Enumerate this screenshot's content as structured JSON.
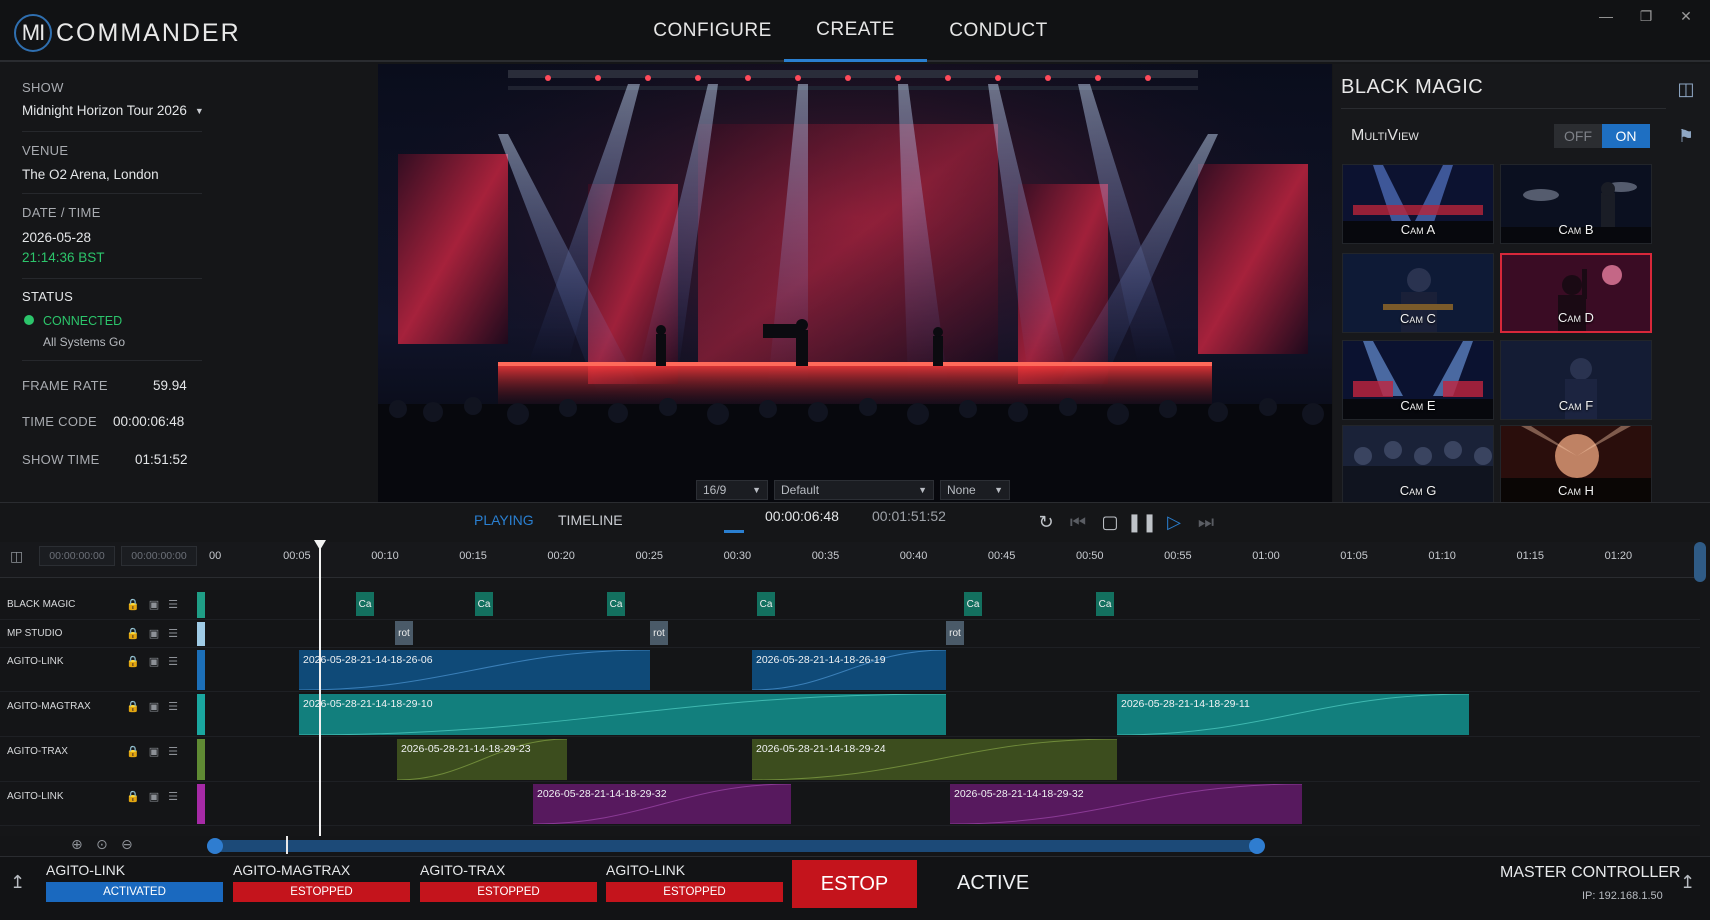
{
  "app": {
    "logo_mark": "MI",
    "logo_text": "COMMANDER",
    "nav": [
      {
        "label": "CONFIGURE"
      },
      {
        "label": "CREATE",
        "active": true
      },
      {
        "label": "CONDUCT"
      }
    ],
    "window_controls": [
      "minimize-icon",
      "restore-icon",
      "close-icon"
    ]
  },
  "show_info": {
    "show_label": "SHOW",
    "show_value": "Midnight Horizon Tour 2026",
    "venue_label": "VENUE",
    "venue_value": "The O2 Arena, London",
    "datetime_label": "DATE / TIME",
    "date_value": "2026-05-28",
    "time_value": "21:14:36 BST",
    "status_label": "STATUS",
    "status_value": "CONNECTED",
    "status_sub": "All Systems Go",
    "frame_rate_label": "FRAME RATE",
    "frame_rate_value": "59.94",
    "time_code_label": "TIME CODE",
    "time_code_value": "00:00:06:48",
    "show_time_label": "SHOW TIME",
    "show_time_value": "01:51:52",
    "status_color": "#2cc56b"
  },
  "viewer": {
    "aspect": "16/9",
    "preset": "Default",
    "overlay": "None"
  },
  "black_magic": {
    "title": "BLACK MAGIC",
    "multiview_label": "MultiView",
    "toggle_off": "OFF",
    "toggle_on": "ON",
    "toggle_state": "ON",
    "cameras": [
      {
        "label": "Cam A"
      },
      {
        "label": "Cam B"
      },
      {
        "label": "Cam C"
      },
      {
        "label": "Cam D",
        "selected": true
      },
      {
        "label": "Cam E"
      },
      {
        "label": "Cam F"
      },
      {
        "label": "Cam G"
      },
      {
        "label": "Cam H"
      }
    ]
  },
  "transport": {
    "tab_playing": "PLAYING",
    "tab_timeline": "TIMELINE",
    "current_time": "00:00:06:48",
    "total_time": "00:01:51:52",
    "accent": "#2a7fd0"
  },
  "timeline": {
    "in_tc": "00:00:00:00",
    "out_tc": "00:00:00:00",
    "ruler_ticks": [
      "00",
      "00:05",
      "00:10",
      "00:15",
      "00:20",
      "00:25",
      "00:30",
      "00:35",
      "00:40",
      "00:45",
      "00:50",
      "00:55",
      "01:00",
      "01:05",
      "01:10",
      "01:15",
      "01:20"
    ],
    "tracks": [
      {
        "name": "BLACK MAGIC",
        "color": "#1f9e86"
      },
      {
        "name": "MP STUDIO",
        "color": "#9fcbe6"
      },
      {
        "name": "AGITO-LINK",
        "color": "#1c6fb8"
      },
      {
        "name": "AGITO-MAGTRAX",
        "color": "#1aa7a0"
      },
      {
        "name": "AGITO-TRAX",
        "color": "#5f8a33"
      },
      {
        "name": "AGITO-LINK",
        "color": "#a62aa6"
      }
    ],
    "cue_markers": {
      "black_magic": "Ca",
      "mp_studio": "rot"
    },
    "clips": {
      "link1_a": "2026-05-28-21-14-18-26-06",
      "link1_b": "2026-05-28-21-14-18-26-19",
      "magtrax_a": "2026-05-28-21-14-18-29-10",
      "magtrax_b": "2026-05-28-21-14-18-29-11",
      "trax_a": "2026-05-28-21-14-18-29-23",
      "trax_b": "2026-05-28-21-14-18-29-24",
      "link2_a": "2026-05-28-21-14-18-29-32",
      "link2_b": "2026-05-28-21-14-18-29-32"
    }
  },
  "status_bar": {
    "devices": [
      {
        "name": "AGITO-LINK",
        "state": "ACTIVATED"
      },
      {
        "name": "AGITO-MAGTRAX",
        "state": "ESTOPPED"
      },
      {
        "name": "AGITO-TRAX",
        "state": "ESTOPPED"
      },
      {
        "name": "AGITO-LINK",
        "state": "ESTOPPED"
      }
    ],
    "estop_label": "ESTOP",
    "mode_label": "ACTIVE",
    "master_label": "MASTER CONTROLLER",
    "ip_label": "IP: 192.168.1.50",
    "estop_color": "#c4141c",
    "activated_color": "#1a69bf"
  }
}
